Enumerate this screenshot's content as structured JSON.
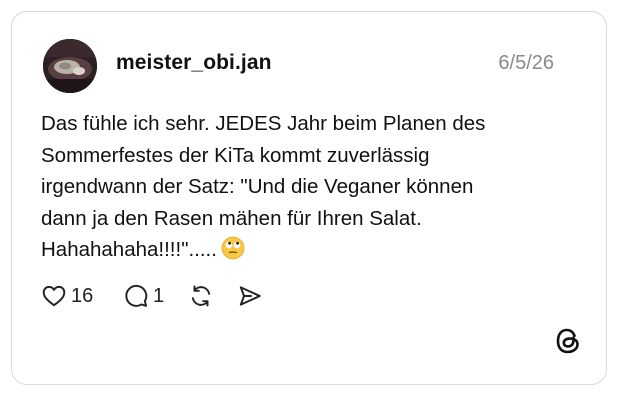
{
  "post": {
    "username": "meister_obi.jan",
    "date": "6/5/26",
    "text_lines": [
      "Das fühle ich sehr. JEDES Jahr beim Planen des",
      "Sommerfestes der KiTa kommt zuverlässig",
      "irgendwann der Satz: \"Und die Veganer können",
      "dann ja den Rasen mähen für Ihren Salat.",
      "Hahahahaha!!!!\"....."
    ],
    "emoji": "rolling-eyes-emoji"
  },
  "actions": {
    "likes": "16",
    "replies": "1"
  },
  "icons": {
    "like": "heart-icon",
    "reply": "speech-bubble-icon",
    "repost": "repost-icon",
    "share": "send-icon",
    "brand": "threads-logo-icon"
  }
}
